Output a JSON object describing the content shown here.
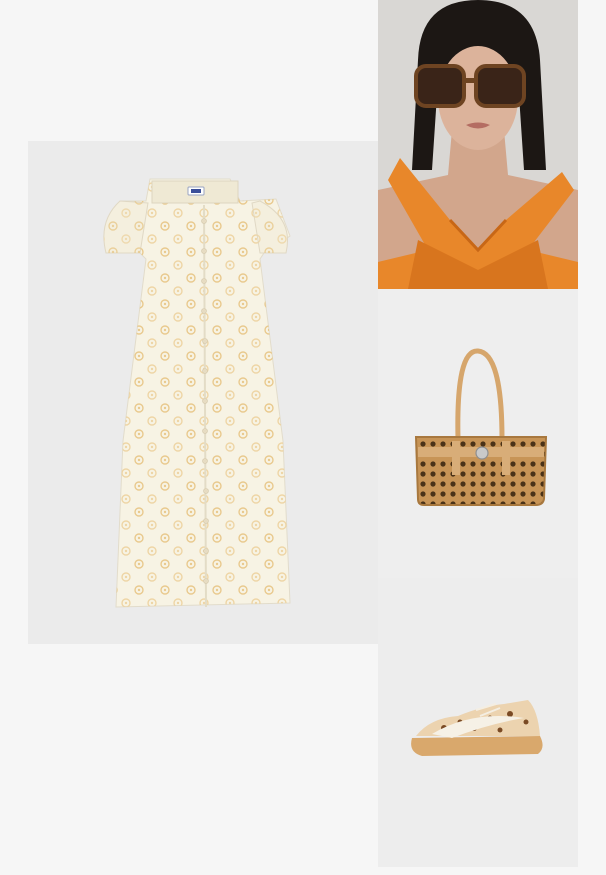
{
  "collage": {
    "items": [
      {
        "key": "dress",
        "icon": "floral-midi-dress-image",
        "colors": {
          "fabric": "#f8f4e6",
          "print": "#e9c98a"
        }
      },
      {
        "key": "model",
        "icon": "model-sunglasses-orange-top-image",
        "colors": {
          "top": "#e98a2a",
          "lens": "#4a3020"
        }
      },
      {
        "key": "bag",
        "icon": "woven-raffia-tote-bag-image",
        "colors": {
          "weave": "#c9995a",
          "strap": "#d9ae78"
        }
      },
      {
        "key": "sneaker",
        "icon": "leopard-print-sneaker-image",
        "colors": {
          "base": "#e8c9a0",
          "sole": "#d8a66a"
        }
      }
    ]
  }
}
